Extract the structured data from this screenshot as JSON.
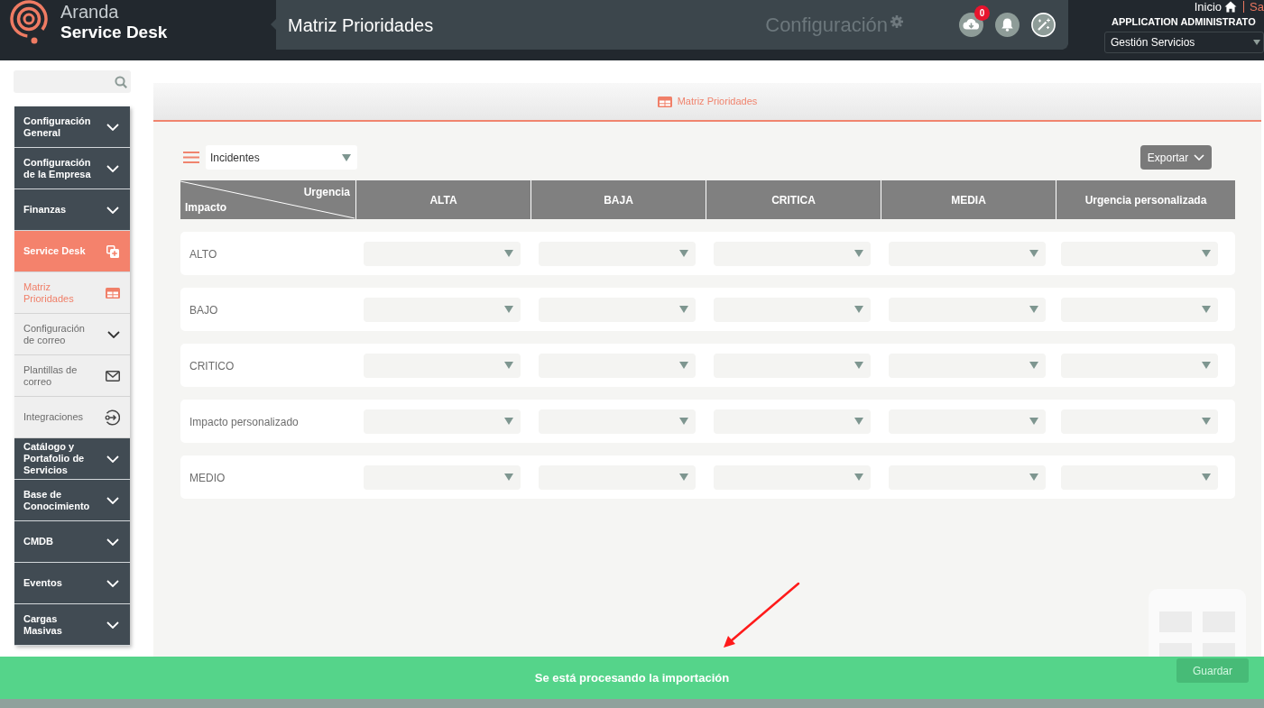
{
  "header": {
    "brand": {
      "line1": "Aranda",
      "line2": "Service Desk"
    },
    "page_title": "Matriz Prioridades",
    "section": "Configuración",
    "downloads_badge": "0",
    "home_link": "Inicio",
    "logout_link": "Sa",
    "user_name": "APPLICATION ADMINISTRATO",
    "project_select": {
      "value": "Gestión Servicios"
    }
  },
  "sidebar": {
    "items": [
      {
        "label": "Configuración General",
        "selected": false,
        "expanded": false
      },
      {
        "label": "Configuración de la Empresa",
        "selected": false,
        "expanded": false
      },
      {
        "label": "Finanzas",
        "selected": false,
        "expanded": false
      },
      {
        "label": "Service Desk",
        "selected": true,
        "expanded": true,
        "children": [
          {
            "label": "Matriz Prioridades",
            "kind": "page",
            "selected": true
          },
          {
            "label": "Configuración de correo",
            "kind": "submenu",
            "selected": false,
            "expanded": false
          },
          {
            "label": "Plantillas de correo",
            "kind": "page",
            "selected": false
          },
          {
            "label": "Integraciones",
            "kind": "page",
            "selected": false
          }
        ]
      },
      {
        "label": "Catálogo y Portafolio de Servicios",
        "selected": false,
        "expanded": false
      },
      {
        "label": "Base de Conocimiento",
        "selected": false,
        "expanded": false
      },
      {
        "label": "CMDB",
        "selected": false,
        "expanded": false
      },
      {
        "label": "Eventos",
        "selected": false,
        "expanded": false
      },
      {
        "label": "Cargas Masivas",
        "selected": false,
        "expanded": false
      }
    ]
  },
  "panel": {
    "title": "Matriz Prioridades",
    "type_select": {
      "value": "Incidentes"
    },
    "export_button": "Exportar",
    "matrix": {
      "column_axis": "Urgencia",
      "row_axis": "Impacto",
      "columns": [
        "ALTA",
        "BAJA",
        "CRITICA",
        "MEDIA",
        "Urgencia personalizada"
      ],
      "rows": [
        "ALTO",
        "BAJO",
        "CRITICO",
        "Impacto personalizado",
        "MEDIO"
      ]
    },
    "save_button": "Guardar"
  },
  "notification": {
    "message": "Se está procesando la importación"
  }
}
